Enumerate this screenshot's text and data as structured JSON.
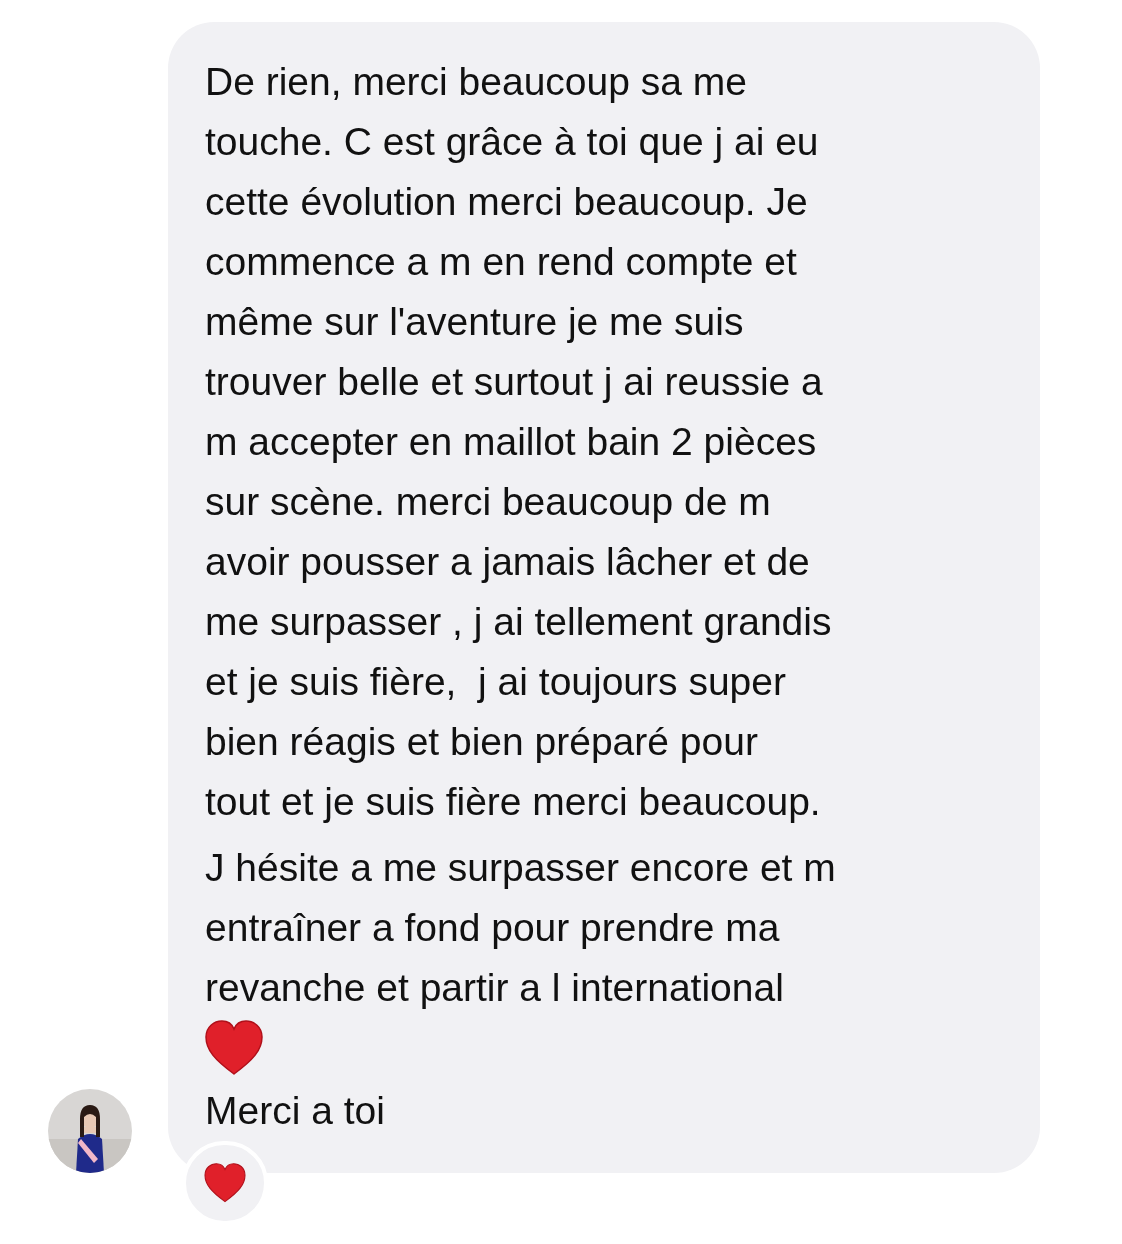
{
  "message": {
    "paragraphs": [
      "De rien, merci beaucoup sa me\ntouche. C est grâce à toi que j ai eu\ncette évolution merci beaucoup. Je\ncommence a m en rend compte et\nmême sur l'aventure je me suis\ntrouver belle et surtout j ai reussie a\nm accepter en maillot bain 2 pièces\nsur scène. merci beaucoup de m\navoir pousser a jamais lâcher et de\nme surpasser , j ai tellement grandis\net je suis fière,  j ai toujours super\nbien réagis et bien préparé pour\ntout et je suis fière merci beaucoup.",
      "J hésite a me surpasser encore et m\nentraîner a fond pour prendre ma\nrevanche et partir a l international"
    ],
    "closing": "Merci a toi",
    "reaction": {
      "kind": "heart"
    }
  }
}
